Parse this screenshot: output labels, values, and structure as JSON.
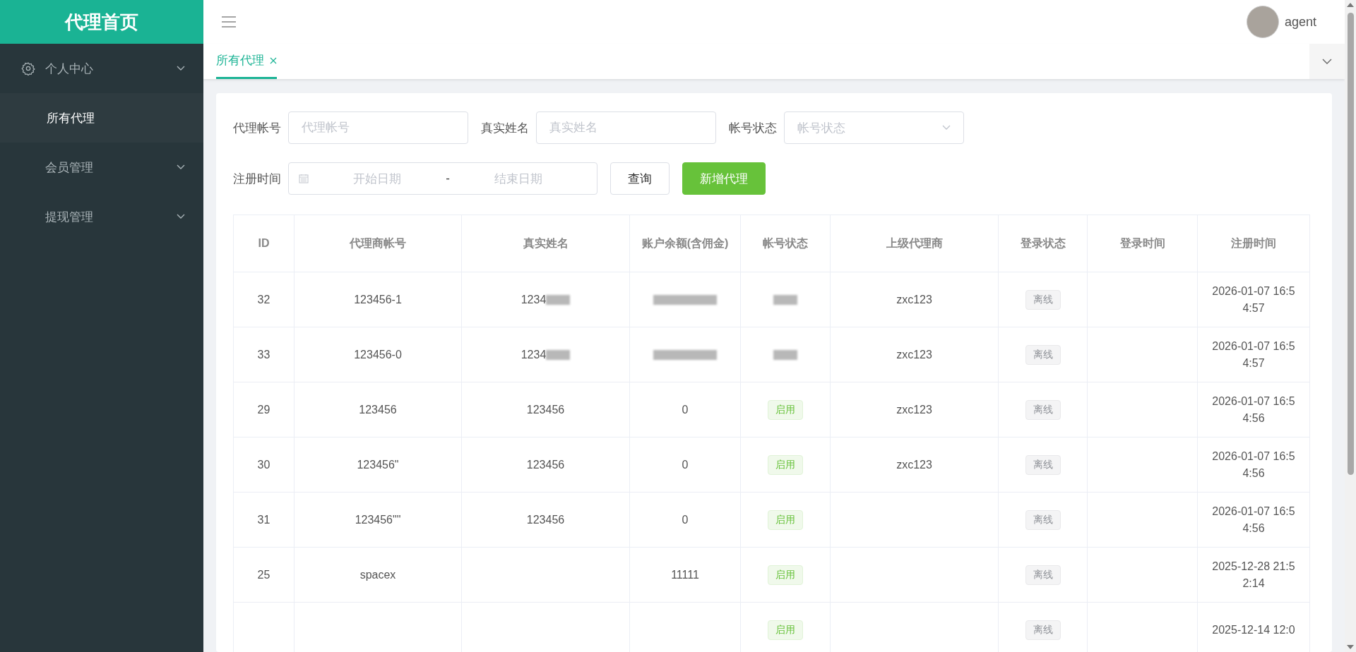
{
  "sidebar": {
    "title": "代理首页",
    "items": [
      {
        "label": "个人中心",
        "icon": true,
        "children": [
          {
            "label": "所有代理",
            "selected": true
          }
        ]
      },
      {
        "label": "会员管理",
        "icon": false
      },
      {
        "label": "提现管理",
        "icon": false
      }
    ]
  },
  "header": {
    "user": "agent"
  },
  "tabs": [
    {
      "label": "所有代理",
      "selected": true,
      "closable": true
    }
  ],
  "filters": [
    {
      "label": "代理帐号",
      "kind": "text",
      "placeholder": "代理帐号"
    },
    {
      "label": "真实姓名",
      "kind": "text",
      "placeholder": "真实姓名"
    },
    {
      "label": "帐号状态",
      "kind": "select",
      "placeholder": "帐号状态"
    },
    {
      "label": "注册时间",
      "kind": "daterange",
      "placeholder": "开始日期",
      "placeholder_end": "结束日期",
      "separator": "-"
    }
  ],
  "buttons": [
    {
      "label": "查询",
      "kind": "default"
    },
    {
      "label": "新增代理",
      "kind": "primary"
    }
  ],
  "table": {
    "columns": [
      "ID",
      "代理商帐号",
      "真实姓名",
      "账户余额(含佣金)",
      "帐号状态",
      "上级代理商",
      "登录状态",
      "登录时间",
      "注册时间"
    ],
    "rows": [
      {
        "id": "32",
        "account": "123456-1",
        "name": "1234",
        "name_redacted": true,
        "balance_redacted": true,
        "status": {
          "kind": "redacted"
        },
        "superior": "zxc123",
        "login_status": "离线",
        "reg_time": "2026-01-07 16:54:57"
      },
      {
        "id": "33",
        "account": "123456-0",
        "name": "1234",
        "name_redacted": true,
        "balance_redacted": true,
        "status": {
          "kind": "redacted"
        },
        "superior": "zxc123",
        "login_status": "离线",
        "reg_time": "2026-01-07 16:54:57"
      },
      {
        "id": "29",
        "account": "123456",
        "name": "123456",
        "name_redacted": false,
        "balance": "0",
        "balance_redacted": false,
        "status": {
          "text": "启用",
          "kind": "enabled"
        },
        "superior": "zxc123",
        "login_status": "离线",
        "reg_time": "2026-01-07 16:54:56"
      },
      {
        "id": "30",
        "account": "123456\"",
        "name": "123456",
        "name_redacted": false,
        "balance": "0",
        "balance_redacted": false,
        "status": {
          "text": "启用",
          "kind": "enabled"
        },
        "superior": "zxc123",
        "login_status": "离线",
        "reg_time": "2026-01-07 16:54:56"
      },
      {
        "id": "31",
        "account": "123456\"\"",
        "name": "123456",
        "name_redacted": false,
        "balance": "0",
        "balance_redacted": false,
        "status": {
          "text": "启用",
          "kind": "enabled"
        },
        "login_status": "离线",
        "reg_time": "2026-01-07 16:54:56"
      },
      {
        "id": "25",
        "account": "spacex",
        "name_redacted": false,
        "balance": "11111",
        "balance_redacted": false,
        "status": {
          "text": "启用",
          "kind": "enabled"
        },
        "login_status": "离线",
        "reg_time": "2025-12-28 21:52:14"
      },
      {
        "name_redacted": false,
        "balance_redacted": false,
        "status": {
          "text": "启用",
          "kind": "enabled"
        },
        "login_status": "离线",
        "reg_time": "2025-12-14 12:0"
      }
    ]
  }
}
